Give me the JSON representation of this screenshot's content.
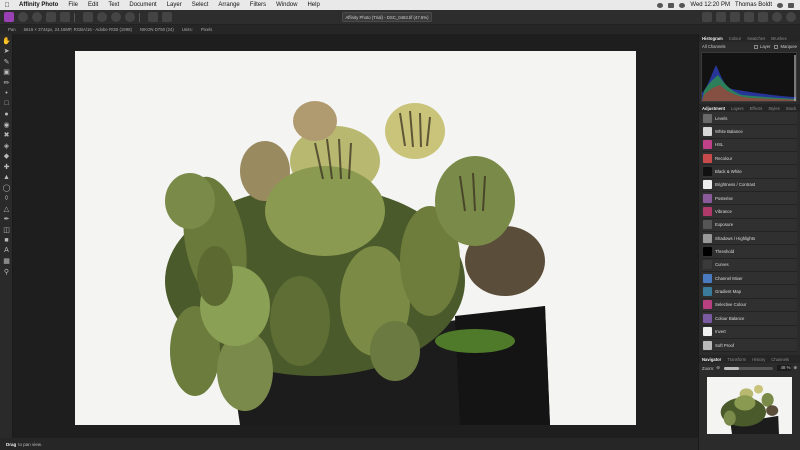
{
  "menubar": {
    "app_name": "Affinity Photo",
    "menus": [
      "File",
      "Edit",
      "Text",
      "Document",
      "Layer",
      "Select",
      "Arrange",
      "Filters",
      "Window",
      "Help"
    ],
    "clock": "Wed 12:20 PM",
    "user": "Thomas Boldt"
  },
  "toolbar": {
    "document_title": "Affinity Photo (Trial) - DSC_0463.tif (47.6%)"
  },
  "contextbar": {
    "tool": "Pan",
    "image_info": "5616 × 3744px, 24.16MP, RGBA/16 - Adobe RGB (1998)",
    "camera": "NIKON D750 (24)",
    "units_label": "Units:",
    "units_value": "Pixels"
  },
  "histogram_panel": {
    "tabs": [
      "Histogram",
      "Colour",
      "Swatches",
      "Brushes"
    ],
    "active_tab": "Histogram",
    "channel": "All Channels",
    "layer_label": "Layer",
    "marquee_label": "Marquee"
  },
  "adjustment_panel": {
    "tabs": [
      "Adjustment",
      "Layers",
      "Effects",
      "Styles",
      "Stock"
    ],
    "active_tab": "Adjustment",
    "items": [
      {
        "label": "Levels",
        "color": "#6a6a6a"
      },
      {
        "label": "White Balance",
        "color": "#d8d8d8"
      },
      {
        "label": "HSL",
        "color": "#c0408a"
      },
      {
        "label": "Recolour",
        "color": "#c84a4a"
      },
      {
        "label": "Black & White",
        "color": "#111111"
      },
      {
        "label": "Brightness / Contrast",
        "color": "#eeeeee"
      },
      {
        "label": "Posterise",
        "color": "#8a5a9a"
      },
      {
        "label": "Vibrance",
        "color": "#b03a6a"
      },
      {
        "label": "Exposure",
        "color": "#555555"
      },
      {
        "label": "Shadows / Highlights",
        "color": "#999999"
      },
      {
        "label": "Threshold",
        "color": "#000000"
      },
      {
        "label": "Curves",
        "color": "#3a3a3a"
      },
      {
        "label": "Channel Mixer",
        "color": "#4a7ac0"
      },
      {
        "label": "Gradient Map",
        "color": "#3a7a9a"
      },
      {
        "label": "Selective Colour",
        "color": "#b84080"
      },
      {
        "label": "Colour Balance",
        "color": "#7a5aa0"
      },
      {
        "label": "Invert",
        "color": "#f0f0f0"
      },
      {
        "label": "Soft Proof",
        "color": "#bbbbbb"
      }
    ]
  },
  "navigator_panel": {
    "tabs": [
      "Navigator",
      "Transform",
      "History",
      "Channels"
    ],
    "active_tab": "Navigator",
    "zoom_label": "Zoom:",
    "zoom_value": "48 %",
    "zoom_fraction": 0.3
  },
  "statusbar": {
    "hint_bold": "Drag",
    "hint_text": "to pan view."
  },
  "colors": {
    "app_accent": "#9b3fb5",
    "panel_bg": "#2b2b2b",
    "canvas_bg": "#1e1e1e"
  }
}
